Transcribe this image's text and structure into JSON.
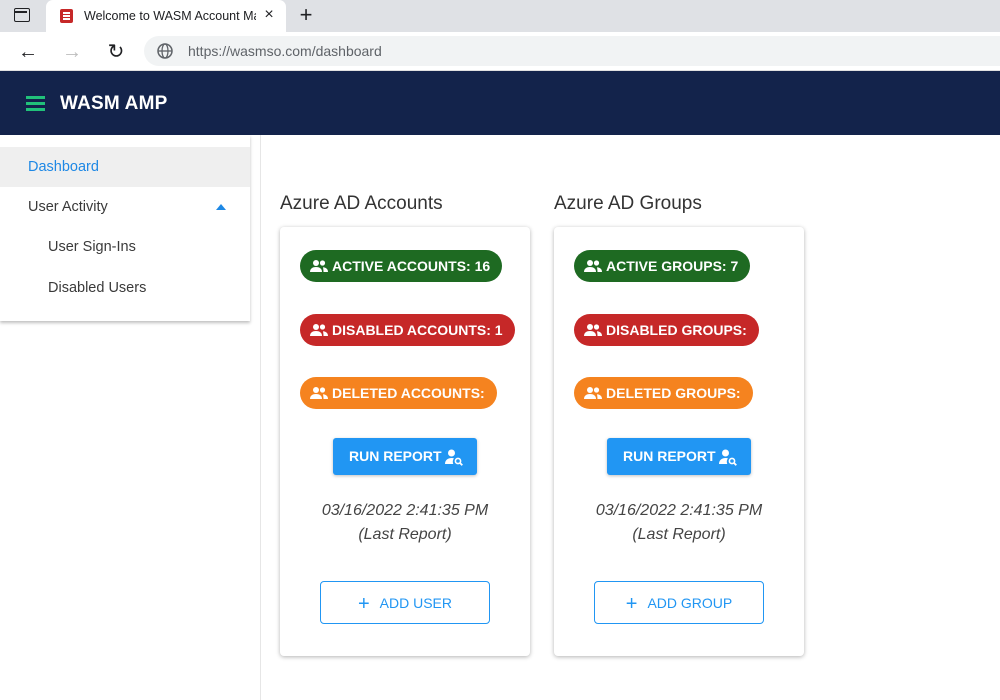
{
  "browser": {
    "tab_title": "Welcome to WASM Account Ma",
    "tab_close": "×",
    "new_tab": "+",
    "back": "←",
    "forward": "→",
    "reload": "↻",
    "url": "https://wasmso.com/dashboard"
  },
  "header": {
    "title": "WASM AMP"
  },
  "sidebar": {
    "items": [
      {
        "label": "Dashboard",
        "active": true
      },
      {
        "label": "User Activity",
        "expanded": true
      },
      {
        "label": "User Sign-Ins"
      },
      {
        "label": "Disabled Users"
      }
    ]
  },
  "accounts": {
    "title": "Azure AD Accounts",
    "active": "ACTIVE ACCOUNTS: 16",
    "disabled": "DISABLED ACCOUNTS: 1",
    "deleted": "DELETED ACCOUNTS:",
    "run_label": "RUN REPORT",
    "report_time": "03/16/2022 2:41:35 PM",
    "report_note": "(Last Report)",
    "add_label": "ADD USER"
  },
  "groups": {
    "title": "Azure AD Groups",
    "active": "ACTIVE GROUPS: 7",
    "disabled": "DISABLED GROUPS:",
    "deleted": "DELETED GROUPS:",
    "run_label": "RUN REPORT",
    "report_time": "03/16/2022 2:41:35 PM",
    "report_note": "(Last Report)",
    "add_label": "ADD GROUP"
  },
  "colors": {
    "header_bg": "#13234b",
    "accent": "#2196f3",
    "chip_green": "#1e6a22",
    "chip_red": "#c62828",
    "chip_orange": "#f5831f"
  },
  "icons": [
    "sidebar-toggle-icon",
    "favicon-icon",
    "globe-icon",
    "menu-icon",
    "people-icon",
    "person-search-icon",
    "plus-icon"
  ]
}
